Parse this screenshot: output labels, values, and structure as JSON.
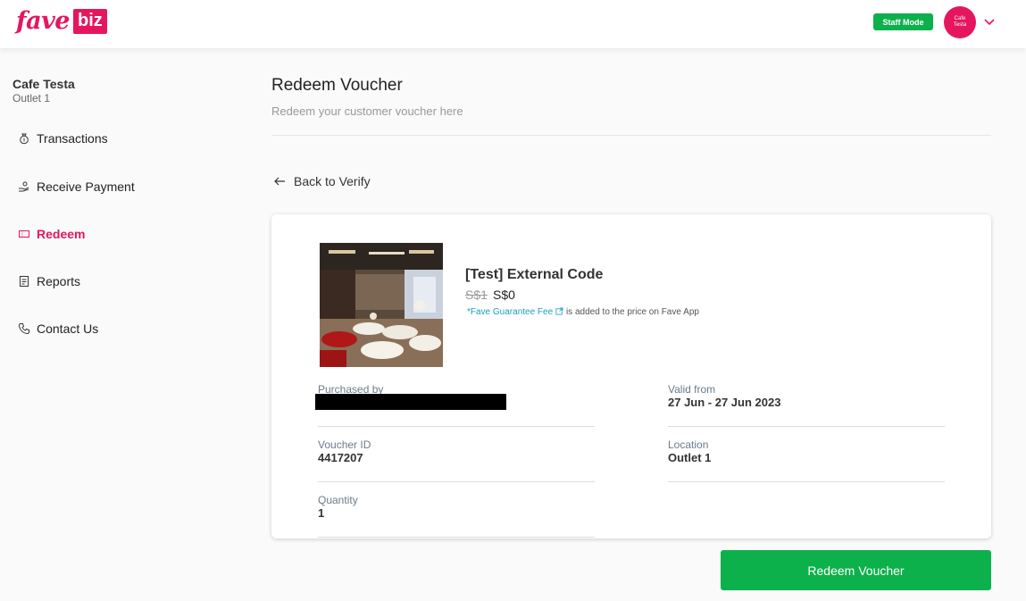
{
  "header": {
    "logo_main": "fave",
    "logo_badge": "biz",
    "staff_mode_label": "Staff Mode",
    "avatar_text": "Cafe Testa"
  },
  "sidebar": {
    "outlet_name": "Cafe Testa",
    "outlet_sub": "Outlet 1",
    "items": [
      {
        "label": "Transactions",
        "icon": "money-bag-icon",
        "active": false
      },
      {
        "label": "Receive Payment",
        "icon": "receive-payment-icon",
        "active": false
      },
      {
        "label": "Redeem",
        "icon": "voucher-icon",
        "active": true
      },
      {
        "label": "Reports",
        "icon": "report-icon",
        "active": false
      },
      {
        "label": "Contact Us",
        "icon": "phone-icon",
        "active": false
      }
    ]
  },
  "main": {
    "title": "Redeem Voucher",
    "subtitle": "Redeem your customer voucher here",
    "back_label": "Back to Verify"
  },
  "voucher": {
    "title": "[Test] External Code",
    "original_price": "S$1",
    "price": "S$0",
    "fee_link": "*Fave Guarantee Fee",
    "fee_note": "is added to the price on Fave App",
    "fields": {
      "purchased_by_label": "Purchased by",
      "valid_from_label": "Valid from",
      "valid_from_value": "27 Jun - 27 Jun 2023",
      "voucher_id_label": "Voucher ID",
      "voucher_id_value": "4417207",
      "location_label": "Location",
      "location_value": "Outlet 1",
      "quantity_label": "Quantity",
      "quantity_value": "1"
    }
  },
  "actions": {
    "redeem_label": "Redeem Voucher"
  },
  "colors": {
    "brand": "#e5165e",
    "success": "#0db14b",
    "link": "#1a9cc4"
  }
}
